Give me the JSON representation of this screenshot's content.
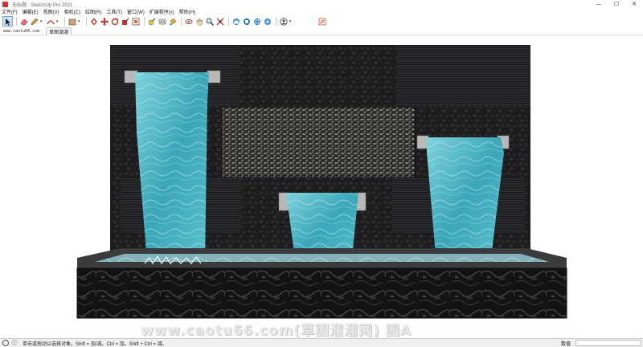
{
  "window": {
    "title": "无标题 - SketchUp Pro 2021",
    "controls": [
      "—",
      "☐",
      "✕"
    ]
  },
  "menu": [
    "文件(F)",
    "编辑(E)",
    "视图(V)",
    "相机(C)",
    "绘图(R)",
    "工具(T)",
    "窗口(W)",
    "扩展程序(x)",
    "帮助(H)"
  ],
  "toolbar": {
    "tools": [
      {
        "name": "select-icon",
        "active": true
      },
      {
        "name": "eraser-icon"
      },
      {
        "name": "pencil-icon",
        "drop": true
      },
      {
        "name": "arc-icon",
        "drop": true
      },
      {
        "name": "rectangle-icon",
        "drop": true
      },
      {
        "name": "pushpull-icon"
      },
      {
        "name": "move-icon"
      },
      {
        "name": "rotate-icon"
      },
      {
        "name": "scale-icon"
      },
      {
        "name": "offset-icon"
      },
      {
        "name": "tape-icon"
      },
      {
        "name": "text-icon"
      },
      {
        "name": "paint-icon"
      },
      {
        "name": "orbit-icon"
      },
      {
        "name": "pan-icon"
      },
      {
        "name": "zoom-icon"
      },
      {
        "name": "zoom-extents-icon"
      },
      {
        "name": "warehouse-icon"
      },
      {
        "name": "extension-warehouse-icon"
      },
      {
        "name": "layout-icon"
      },
      {
        "name": "extension-manager-icon"
      },
      {
        "name": "user-account-icon",
        "drop": true
      },
      {
        "name": "edit-icon"
      }
    ]
  },
  "scene": {
    "watermark_small": "www.caotu66.com",
    "tab_label": "草图溜溜"
  },
  "viewport_watermark": "www.caotu66.com(草图溜溜网) 图A",
  "status": {
    "hint": "单击或拖动以选择对象。Shift = 加/减。Ctrl = 加。Shift + Ctrl = 减。",
    "measurements_label": "数值",
    "measurements_value": ""
  },
  "colors": {
    "wall_dark": "#1c1c1e",
    "stripe": "#2b2c2f",
    "water": "#4fb4c4",
    "spout": "#b9b9b9",
    "basin_marble": "#141414"
  }
}
